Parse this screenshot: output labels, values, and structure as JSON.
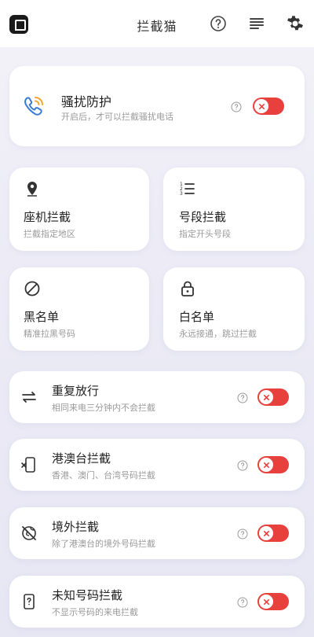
{
  "app": {
    "title": "拦截猫"
  },
  "harassment": {
    "title": "骚扰防护",
    "subtitle": "开启后，才可以拦截骚扰电话",
    "enabled": false
  },
  "tiles": [
    {
      "title": "座机拦截",
      "subtitle": "拦截指定地区",
      "icon": "location-pin-icon"
    },
    {
      "title": "号段拦截",
      "subtitle": "指定开头号段",
      "icon": "numbered-list-icon"
    },
    {
      "title": "黑名单",
      "subtitle": "精准拉黑号码",
      "icon": "block-icon"
    },
    {
      "title": "白名单",
      "subtitle": "永远接通，跳过拦截",
      "icon": "lock-icon"
    }
  ],
  "rows": [
    {
      "title": "重复放行",
      "subtitle": "相同来电三分钟内不会拦截",
      "icon": "repeat-arrows-icon",
      "enabled": false
    },
    {
      "title": "港澳台拦截",
      "subtitle": "香港、澳门、台湾号码拦截",
      "icon": "phone-cross-icon",
      "enabled": false
    },
    {
      "title": "境外拦截",
      "subtitle": "除了港澳台的境外号码拦截",
      "icon": "globe-off-icon",
      "enabled": false
    },
    {
      "title": "未知号码拦截",
      "subtitle": "不显示号码的来电拦截",
      "icon": "phone-unknown-icon",
      "enabled": false
    }
  ],
  "colors": {
    "toggle_off": "#e8403c",
    "accent_blue": "#3a7bd5",
    "accent_orange": "#f0a630"
  }
}
